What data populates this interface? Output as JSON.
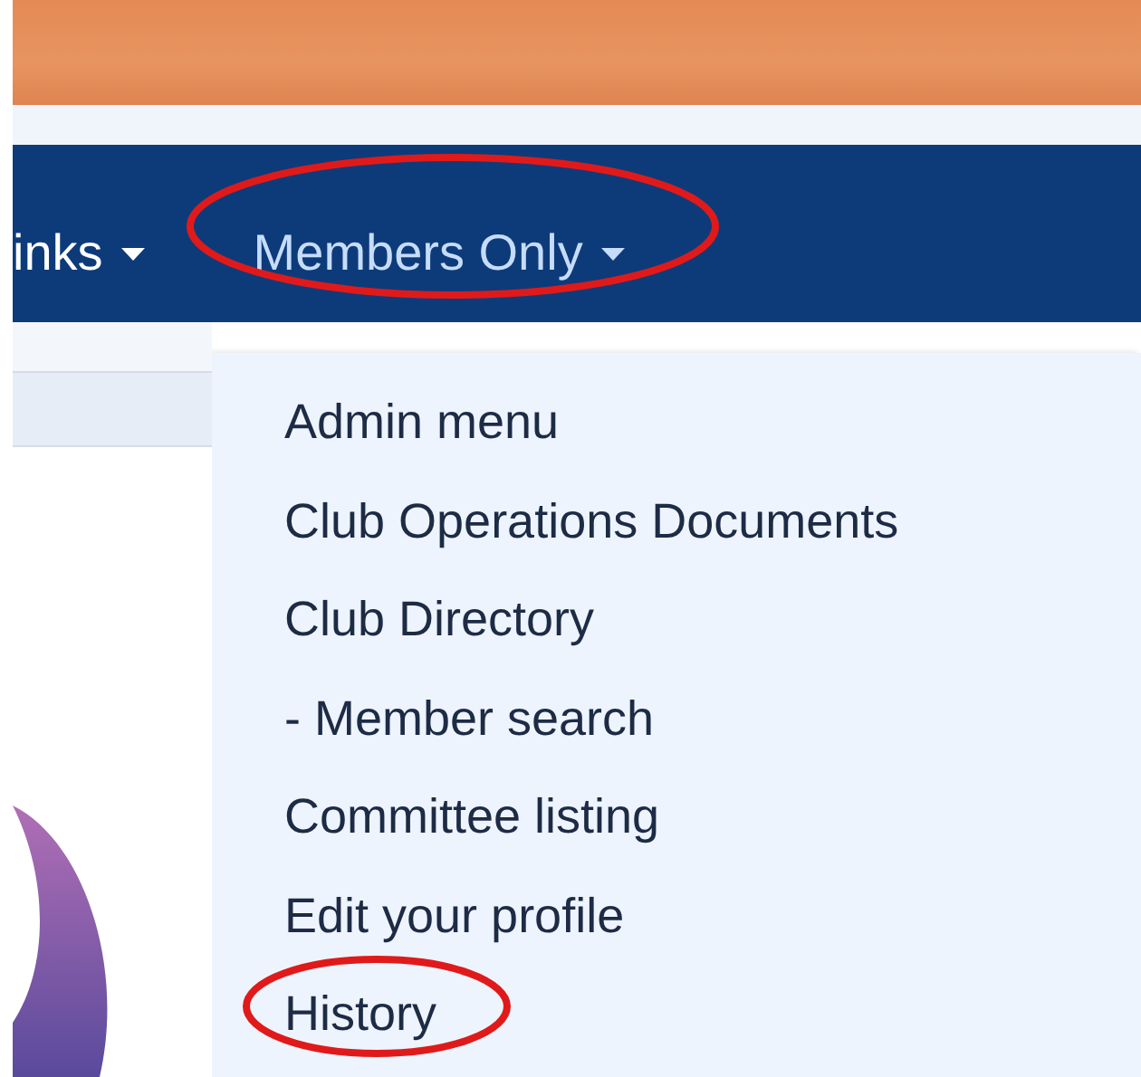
{
  "nav_items": [
    {
      "label": "inks",
      "selected": false
    },
    {
      "label": "Members Only",
      "selected": true
    }
  ],
  "dropdown_items": [
    "Admin menu",
    "Club Operations Documents",
    "Club Directory",
    "- Member search",
    "Committee listing",
    "Edit your profile",
    "History"
  ]
}
